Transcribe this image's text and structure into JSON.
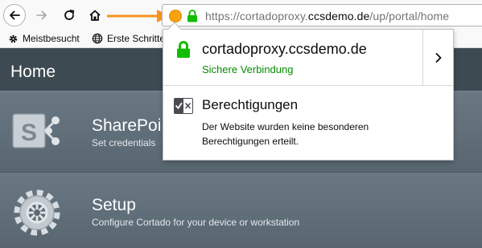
{
  "browser": {
    "url_prefix": "https://cortadoproxy.",
    "url_domain": "ccsdemo.de",
    "url_path": "/up/portal/home",
    "bookmarks": [
      {
        "label": "Meistbesucht",
        "icon": "gear-icon"
      },
      {
        "label": "Erste Schritte",
        "icon": "globe-icon"
      }
    ],
    "annotation_color": "#f7931e"
  },
  "popup": {
    "host": "cortadoproxy.ccsdemo.de",
    "connection_status": "Sichere Verbindung",
    "permissions_title": "Berechtigungen",
    "permissions_text": "Der Website wurden keine besonderen Berechtigungen erteilt.",
    "secure_color": "#058b00",
    "lock_color": "#12bc00"
  },
  "page": {
    "title": "Home",
    "tiles": [
      {
        "name": "SharePoi",
        "description": "Set credentials",
        "icon": "sharepoint-icon"
      },
      {
        "name": "Setup",
        "description": "Configure Cortado for your device or workstation",
        "icon": "cog-icon"
      }
    ]
  }
}
